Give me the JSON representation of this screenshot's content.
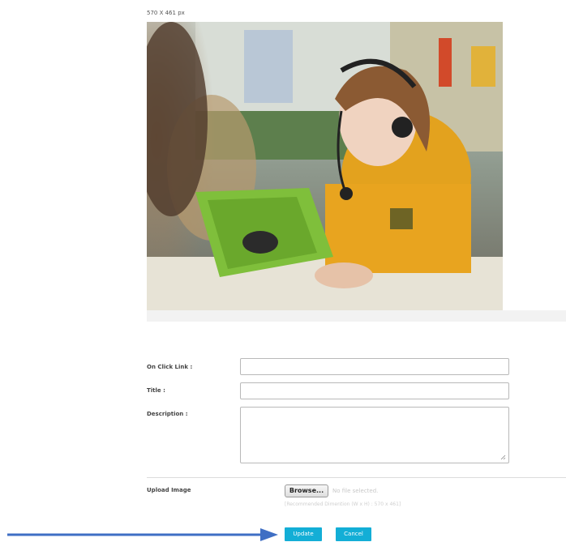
{
  "image_dimension_label": "570 X 461 px",
  "form": {
    "on_click_link_label": "On Click Link :",
    "title_label": "Title :",
    "description_label": "Description :",
    "on_click_link_value": "",
    "title_value": "",
    "description_value": ""
  },
  "upload": {
    "label": "Upload Image",
    "browse_label": "Browse...",
    "no_file_text": "No file selected.",
    "recommended_text": "[Recommended Dimention (W x H) : 570 x 461]"
  },
  "actions": {
    "update_label": "Update",
    "cancel_label": "Cancel"
  },
  "colors": {
    "button_accent": "#13aed6",
    "arrow": "#3f6fc4"
  },
  "icons": {
    "arrow": "right-arrow-icon",
    "resize": "resize-grip-icon"
  }
}
